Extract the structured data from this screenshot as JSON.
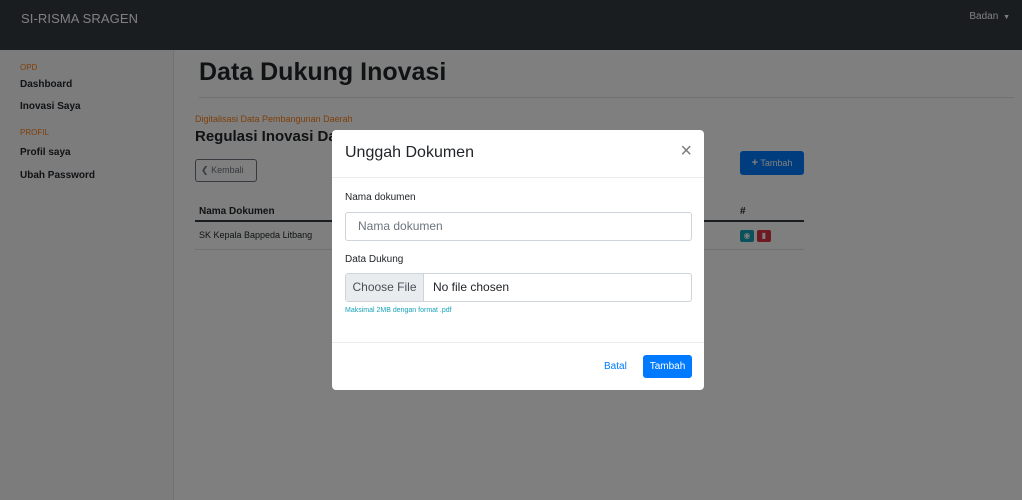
{
  "navbar": {
    "brand": "SI-RISMA SRAGEN",
    "user": "Badan",
    "caret": "▼"
  },
  "sidebar": {
    "sections": [
      {
        "heading": "OPD",
        "items": [
          "Dashboard",
          "Inovasi Saya"
        ]
      },
      {
        "heading": "PROFIL",
        "items": [
          "Profil saya",
          "Ubah Password"
        ]
      }
    ]
  },
  "main": {
    "title": "Data Dukung Inovasi",
    "caption": "Digitalisasi Data Pembangunan Daerah",
    "section_title": "Regulasi Inovasi Daerah",
    "back_label": "Kembali",
    "add_label": "Tambah",
    "table": {
      "headers": [
        "Nama Dokumen",
        "#"
      ],
      "rows": [
        {
          "name": "SK Kepala Bappeda Litbang"
        }
      ]
    }
  },
  "modal": {
    "title": "Unggah Dokumen",
    "close": "×",
    "name_label": "Nama dokumen",
    "name_placeholder": "Nama dokumen",
    "file_label": "Data Dukung",
    "file_button": "Choose File",
    "file_status": "No file chosen",
    "help": "Maksimal 2MB dengan format .pdf",
    "cancel_label": "Batal",
    "submit_label": "Tambah"
  },
  "colors": {
    "navbar": "#343a40",
    "accent": "#007bff",
    "orange": "#fd7e14",
    "info": "#17a2b8",
    "danger": "#dc3545"
  }
}
